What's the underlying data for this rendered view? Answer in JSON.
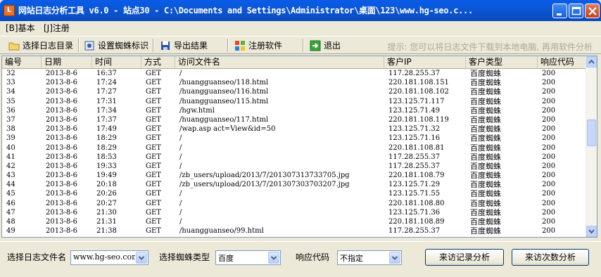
{
  "window": {
    "title": "网站日志分析工具 v6.0 - 站点30 - C:\\Documents and Settings\\Administrator\\桌面\\123\\www.hg-seo.c...",
    "icon_label": "L"
  },
  "menu": [
    "[B]基本",
    "[J]注册"
  ],
  "toolbar": {
    "buttons": [
      {
        "label": "选择日志目录",
        "icon": "folder-icon"
      },
      {
        "label": "设置蜘蛛标识",
        "icon": "settings-icon"
      },
      {
        "label": "导出结果",
        "icon": "save-icon"
      },
      {
        "label": "注册软件",
        "icon": "windows-logo-icon"
      },
      {
        "label": "退出",
        "icon": "exit-icon"
      }
    ],
    "tip": "提示: 您可以将日志文件下载到本地电脑, 再用软件分析"
  },
  "table": {
    "columns": [
      "编号",
      "日期",
      "时间",
      "方式",
      "访问文件名",
      "客户IP",
      "客户类型",
      "响应代码"
    ],
    "rows": [
      [
        "32",
        "2013-8-6",
        "16:37",
        "GET",
        "/",
        "117.28.255.37",
        "百度蜘蛛",
        "200"
      ],
      [
        "33",
        "2013-8-6",
        "17:24",
        "GET",
        "/huangguanseo/118.html",
        "220.181.108.151",
        "百度蜘蛛",
        "200"
      ],
      [
        "34",
        "2013-8-6",
        "17:27",
        "GET",
        "/huangguanseo/116.html",
        "220.181.108.102",
        "百度蜘蛛",
        "200"
      ],
      [
        "35",
        "2013-8-6",
        "17:31",
        "GET",
        "/huangguanseo/115.html",
        "123.125.71.117",
        "百度蜘蛛",
        "200"
      ],
      [
        "36",
        "2013-8-6",
        "17:34",
        "GET",
        "/hgw.html",
        "123.125.71.49",
        "百度蜘蛛",
        "200"
      ],
      [
        "37",
        "2013-8-6",
        "17:37",
        "GET",
        "/huangguanseo/117.html",
        "220.181.108.119",
        "百度蜘蛛",
        "200"
      ],
      [
        "38",
        "2013-8-6",
        "17:49",
        "GET",
        "/wap.asp act=View&id=50",
        "123.125.71.32",
        "百度蜘蛛",
        "200"
      ],
      [
        "39",
        "2013-8-6",
        "18:29",
        "GET",
        "/",
        "123.125.71.16",
        "百度蜘蛛",
        "200"
      ],
      [
        "40",
        "2013-8-6",
        "18:29",
        "GET",
        "/",
        "220.181.108.81",
        "百度蜘蛛",
        "200"
      ],
      [
        "41",
        "2013-8-6",
        "18:53",
        "GET",
        "/",
        "117.28.255.37",
        "百度蜘蛛",
        "200"
      ],
      [
        "42",
        "2013-8-6",
        "19:33",
        "GET",
        "/",
        "117.28.255.37",
        "百度蜘蛛",
        "200"
      ],
      [
        "43",
        "2013-8-6",
        "19:49",
        "GET",
        "/zb_users/upload/2013/7/201307313733705.jpg",
        "220.181.108.79",
        "百度蜘蛛",
        "200"
      ],
      [
        "44",
        "2013-8-6",
        "20:18",
        "GET",
        "/zb_users/upload/2013/7/201307303703207.jpg",
        "123.125.71.29",
        "百度蜘蛛",
        "200"
      ],
      [
        "45",
        "2013-8-6",
        "20:26",
        "GET",
        "/",
        "123.125.71.55",
        "百度蜘蛛",
        "200"
      ],
      [
        "46",
        "2013-8-6",
        "20:27",
        "GET",
        "/",
        "220.181.108.80",
        "百度蜘蛛",
        "200"
      ],
      [
        "47",
        "2013-8-6",
        "21:30",
        "GET",
        "/",
        "123.125.71.36",
        "百度蜘蛛",
        "200"
      ],
      [
        "48",
        "2013-8-6",
        "21:31",
        "GET",
        "/",
        "220.181.108.89",
        "百度蜘蛛",
        "200"
      ],
      [
        "49",
        "2013-8-6",
        "21:38",
        "GET",
        "/huangguanseo/99.html",
        "117.28.255.37",
        "百度蜘蛛",
        "200"
      ]
    ]
  },
  "bottom": {
    "log_file_label": "选择日志文件名",
    "log_file_value": "www.hg-seo.com",
    "spider_type_label": "选择蜘蛛类型",
    "spider_type_value": "百度",
    "response_code_label": "响应代码",
    "response_code_value": "不指定",
    "visit_record_button": "来访记录分析",
    "visit_count_button": "来访次数分析"
  },
  "colors": {
    "titlebar": "#0a5ce8",
    "window_bg": "#ece9d8",
    "tip_text": "#aca899"
  }
}
